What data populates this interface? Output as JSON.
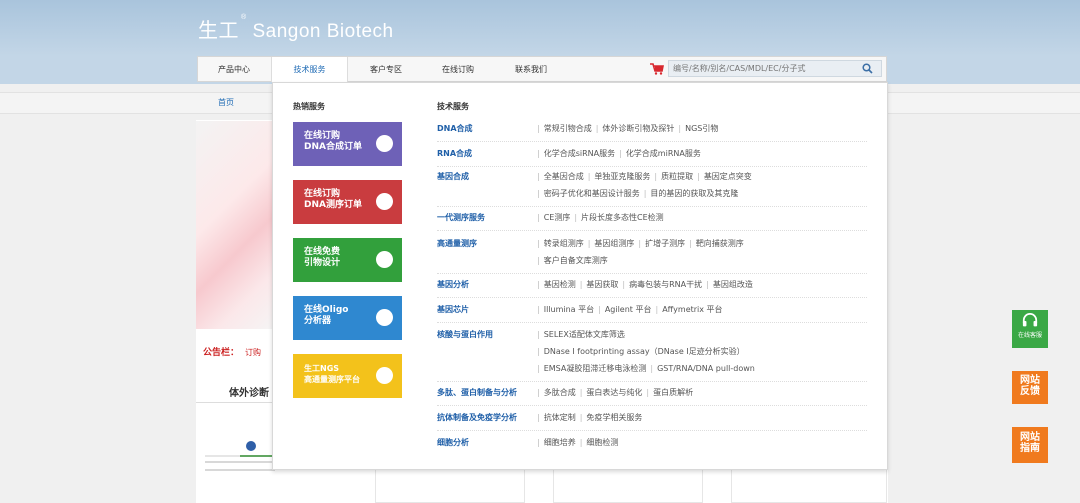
{
  "header": {
    "logo_cn": "生工",
    "logo_reg": "®",
    "logo_en": "Sangon Biotech"
  },
  "nav": {
    "items": [
      "产品中心",
      "技术服务",
      "客户专区",
      "在线订购",
      "联系我们"
    ],
    "active_index": 1,
    "search_placeholder": "编号/名称/别名/CAS/MDL/EC/分子式",
    "accent": "#d8282f"
  },
  "breadcrumb": {
    "home": "首页"
  },
  "notice": {
    "label": "公告栏：",
    "text": "订购"
  },
  "tabs": {
    "diag": "体外诊断"
  },
  "dropdown": {
    "hot_title": "热销服务",
    "promos": [
      {
        "line1": "在线订购",
        "line2": "DNA合成订单",
        "color": "#6e61b7"
      },
      {
        "line1": "在线订购",
        "line2": "DNA测序订单",
        "color": "#c93c3f"
      },
      {
        "line1": "在线免费",
        "line2": "引物设计",
        "color": "#32a03c"
      },
      {
        "line1": "在线Oligo",
        "line2": "分析器",
        "color": "#2f88d0"
      },
      {
        "line1": "生工NGS",
        "line2": "高通量测序平台",
        "color": "#f3c21b"
      }
    ],
    "tech_title": "技术服务",
    "categories": [
      {
        "name": "DNA合成",
        "lines": [
          [
            "常规引物合成",
            "体外诊断引物及探针",
            "NGS引物"
          ]
        ]
      },
      {
        "name": "RNA合成",
        "lines": [
          [
            "化学合成siRNA服务",
            "化学合成miRNA服务"
          ]
        ]
      },
      {
        "name": "基因合成",
        "lines": [
          [
            "全基因合成",
            "单独亚克隆服务",
            "质粒提取",
            "基因定点突变"
          ],
          [
            "密码子优化和基因设计服务",
            "目的基因的获取及其克隆"
          ]
        ]
      },
      {
        "name": "一代测序服务",
        "lines": [
          [
            "CE测序",
            "片段长度多态性CE检测"
          ]
        ]
      },
      {
        "name": "高通量测序",
        "lines": [
          [
            "转录组测序",
            "基因组测序",
            "扩增子测序",
            "靶向捕获测序"
          ],
          [
            "客户自备文库测序"
          ]
        ]
      },
      {
        "name": "基因分析",
        "lines": [
          [
            "基因检测",
            "基因获取",
            "病毒包装与RNA干扰",
            "基因组改造"
          ]
        ]
      },
      {
        "name": "基因芯片",
        "lines": [
          [
            "Illumina 平台",
            "Agilent 平台",
            "Affymetrix 平台"
          ]
        ]
      },
      {
        "name": "核酸与蛋白作用",
        "lines": [
          [
            "SELEX适配体文库筛选"
          ],
          [
            "DNase I footprinting assay（DNase I足迹分析实验）"
          ],
          [
            "EMSA凝胶阻滞迁移电泳检测",
            "GST/RNA/DNA pull-down"
          ]
        ]
      },
      {
        "name": "多肽、蛋白制备与分析",
        "lines": [
          [
            "多肽合成",
            "蛋白表达与纯化",
            "蛋白质解析"
          ]
        ]
      },
      {
        "name": "抗体制备及免疫学分析",
        "lines": [
          [
            "抗体定制",
            "免疫学相关服务"
          ]
        ]
      },
      {
        "name": "细胞分析",
        "lines": [
          [
            "细胞培养",
            "细胞检测"
          ]
        ]
      }
    ]
  },
  "side": {
    "service": {
      "label": "在线客服",
      "color": "#3aa845"
    },
    "feedback": {
      "label1": "网站",
      "label2": "反馈",
      "color": "#f07a1e"
    },
    "guide": {
      "label1": "网站",
      "label2": "指南",
      "color": "#f07a1e"
    }
  }
}
